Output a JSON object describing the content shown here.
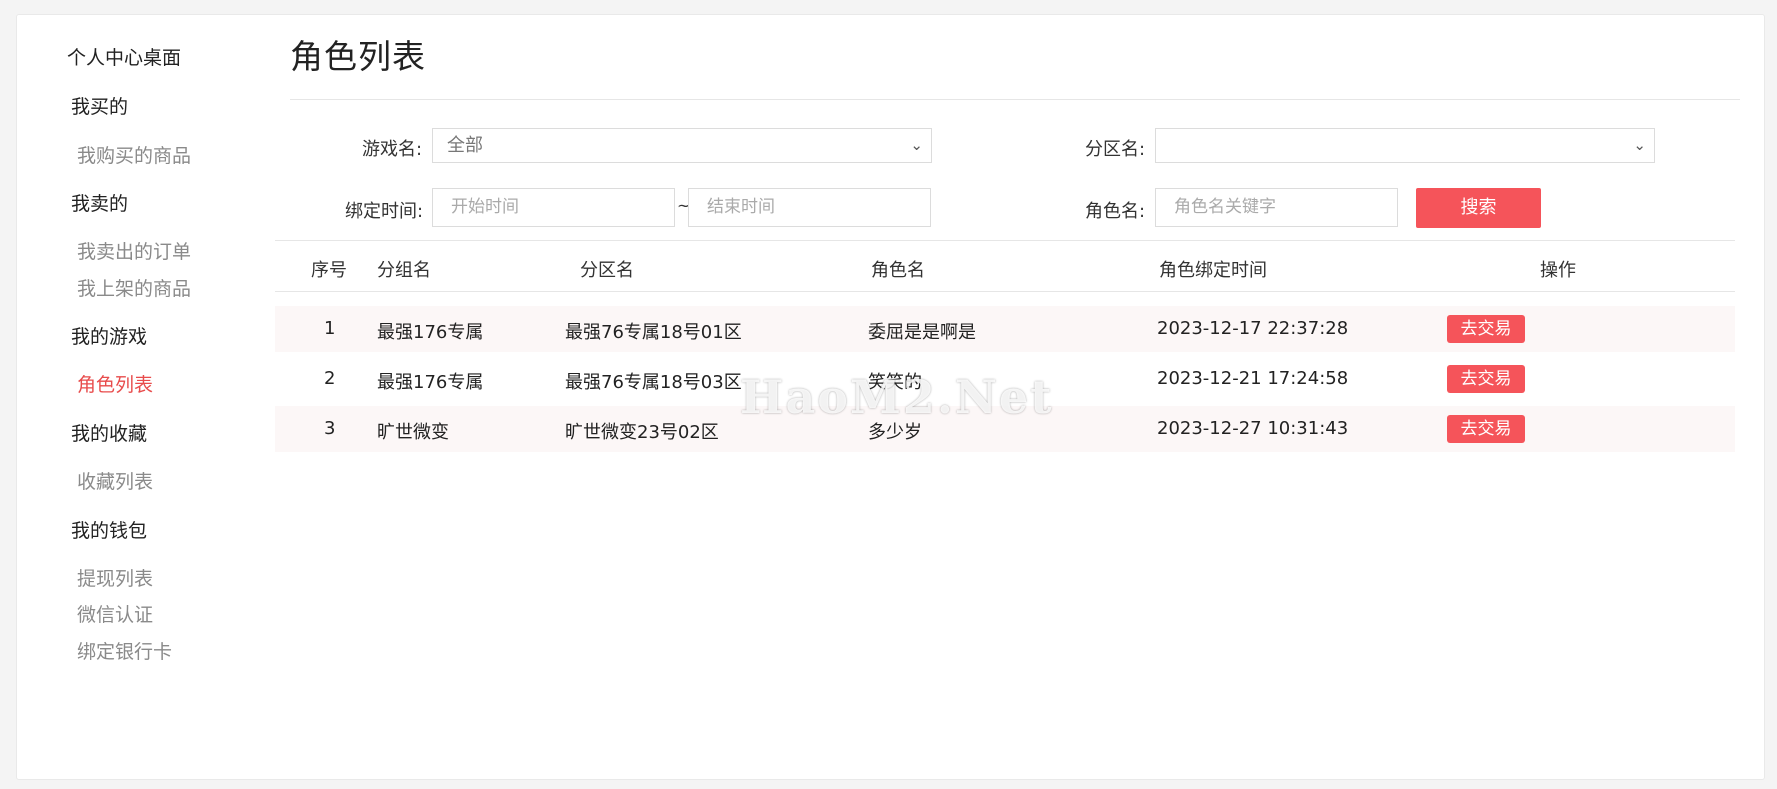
{
  "sidebar": {
    "top": "个人中心桌面",
    "sections": [
      {
        "head": "我买的",
        "items": [
          "我购买的商品"
        ]
      },
      {
        "head": "我卖的",
        "items": [
          "我卖出的订单",
          "我上架的商品"
        ]
      },
      {
        "head": "我的游戏",
        "items": [
          "角色列表"
        ]
      },
      {
        "head": "我的收藏",
        "items": [
          "收藏列表"
        ]
      },
      {
        "head": "我的钱包",
        "items": [
          "提现列表",
          "微信认证",
          "绑定银行卡"
        ]
      }
    ],
    "active_item": "角色列表"
  },
  "page_title": "角色列表",
  "filters": {
    "game_label": "游戏名:",
    "game_value": "全部",
    "zone_label": "分区名:",
    "zone_value": "",
    "bind_time_label": "绑定时间:",
    "start_placeholder": "开始时间",
    "range_sep": "~",
    "end_placeholder": "结束时间",
    "role_label": "角色名:",
    "role_placeholder": "角色名关键字",
    "search_label": "搜索"
  },
  "table": {
    "headers": [
      "序号",
      "分组名",
      "分区名",
      "角色名",
      "角色绑定时间",
      "操作"
    ],
    "rows": [
      {
        "no": "1",
        "group": "最强176专属",
        "zone": "最强76专属18号01区",
        "role": "委屈是是啊是",
        "time": "2023-12-17 22:37:28",
        "action": "去交易"
      },
      {
        "no": "2",
        "group": "最强176专属",
        "zone": "最强76专属18号03区",
        "role": "笑笑的",
        "time": "2023-12-21 17:24:58",
        "action": "去交易"
      },
      {
        "no": "3",
        "group": "旷世微变",
        "zone": "旷世微变23号02区",
        "role": "多少岁",
        "time": "2023-12-27 10:31:43",
        "action": "去交易"
      }
    ]
  },
  "watermark": "HaoM2.Net",
  "colors": {
    "accent": "#f5545a",
    "active_text": "#e84c4c"
  }
}
